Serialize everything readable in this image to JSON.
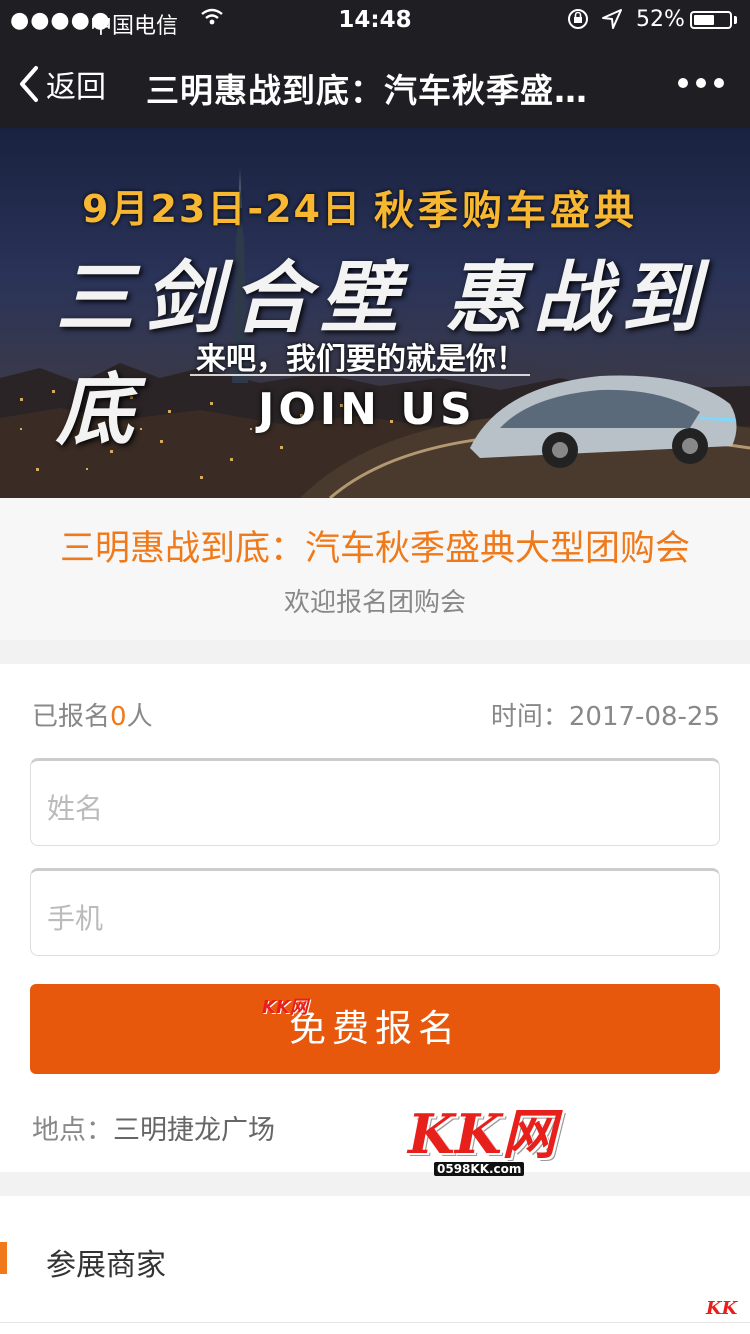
{
  "status_bar": {
    "signal": "●●●●●",
    "carrier": "中国电信",
    "time": "14:48",
    "battery": "52%"
  },
  "nav": {
    "back_label": "返回",
    "title": "三明惠战到底：汽车秋季盛…"
  },
  "banner": {
    "date": "9月23日-24日",
    "festival": "秋季购车盛典",
    "headline": "三剑合壁 惠战到底",
    "subline": "来吧，我们要的就是你！",
    "cta": "JOIN US"
  },
  "event": {
    "title": "三明惠战到底：汽车秋季盛典大型团购会",
    "subtitle": "欢迎报名团购会"
  },
  "form": {
    "count_prefix": "已报名",
    "count": "0",
    "count_suffix": "人",
    "date_label": "时间：2017-08-25",
    "name_placeholder": "姓名",
    "phone_placeholder": "手机",
    "submit_label": "免费报名",
    "location_label": "地点：",
    "location_value": "三明捷龙广场"
  },
  "watermark": {
    "logo_small": "KK网",
    "logo": "KK网",
    "url": "0598KK.com",
    "corner": "KK"
  },
  "exhibitors": {
    "label": "参展商家"
  },
  "colors": {
    "accent": "#f07a1a",
    "button": "#e8580c",
    "navbar": "#1f1e23"
  }
}
